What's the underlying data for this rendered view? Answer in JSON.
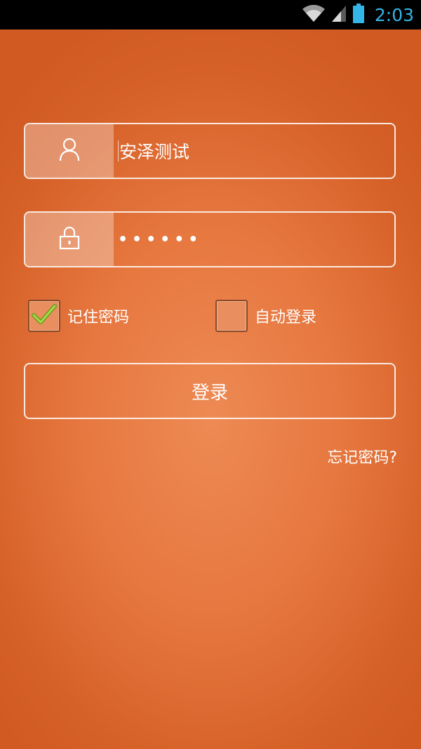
{
  "status_bar": {
    "time": "2:03",
    "icons": [
      "wifi-icon",
      "signal-icon",
      "battery-icon"
    ],
    "time_color": "#33b5e5"
  },
  "login_form": {
    "username": {
      "icon": "user-icon",
      "value": "安泽测试"
    },
    "password": {
      "icon": "lock-icon",
      "masked_value": "••••••"
    },
    "remember_password": {
      "label": "记住密码",
      "checked": true
    },
    "auto_login": {
      "label": "自动登录",
      "checked": false
    },
    "login_button_label": "登录",
    "forgot_password_label": "忘记密码?"
  },
  "colors": {
    "background_center": "#ee8a54",
    "background_edge": "#d05a22",
    "checkmark": "#8bc34a"
  }
}
